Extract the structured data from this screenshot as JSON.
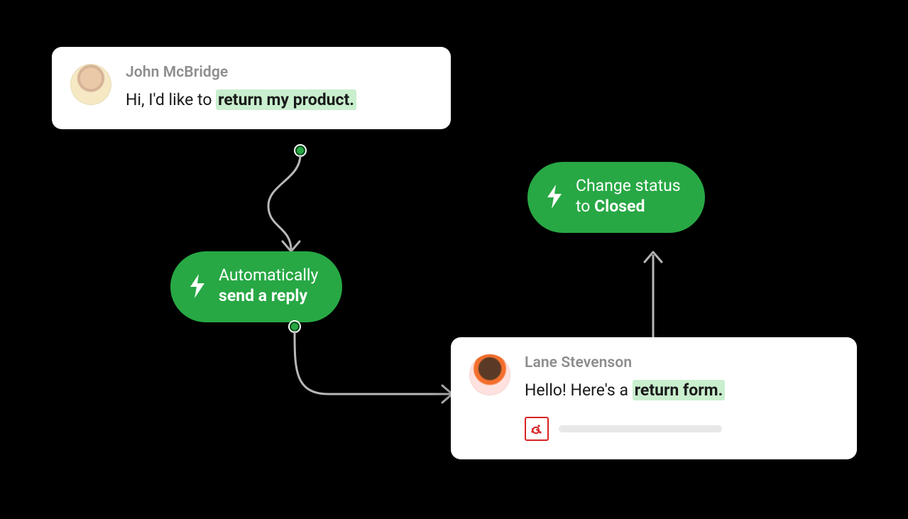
{
  "customer_card": {
    "author": "John McBridge",
    "message_prefix": "Hi, I'd like to ",
    "message_highlight": "return my product."
  },
  "auto_reply_pill": {
    "line1": "Automatically",
    "line2": "send a reply"
  },
  "agent_card": {
    "author": "Lane Stevenson",
    "message_prefix": "Hello! Here's a ",
    "message_highlight": "return form."
  },
  "status_pill": {
    "line1": "Change status",
    "line2_prefix": "to ",
    "line2_bold": "Closed"
  }
}
